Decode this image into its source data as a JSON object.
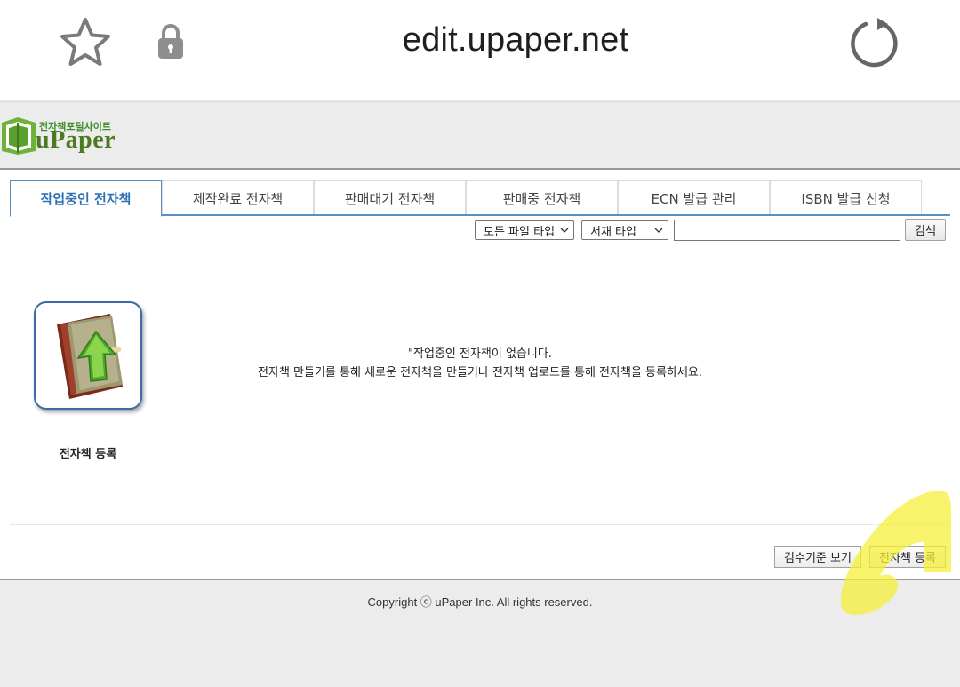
{
  "browser": {
    "url": "edit.upaper.net",
    "icons": [
      "star-icon",
      "lock-icon",
      "reload-icon"
    ]
  },
  "site": {
    "logo_tagline": "전자책포털사이트",
    "logo_name": "uPaper",
    "brand_color": "#4b7a21"
  },
  "tabs": [
    {
      "label": "작업중인 전자책",
      "active": true
    },
    {
      "label": "제작완료 전자책",
      "active": false
    },
    {
      "label": "판매대기 전자책",
      "active": false
    },
    {
      "label": "판매중 전자책",
      "active": false
    },
    {
      "label": "ECN 발급 관리",
      "active": false
    },
    {
      "label": "ISBN 발급 신청",
      "active": false
    }
  ],
  "filters": {
    "file_type": "모든 파일 타입",
    "book_type": "서재 타입",
    "search_value": "",
    "search_button": "검색"
  },
  "content": {
    "register_label": "전자책 등록",
    "empty_line1": "\"작업중인 전자책이 없습니다.",
    "empty_line2": "전자책 만들기를 통해 새로운 전자책을 만들거나 전자책 업로드를 통해 전자책을 등록하세요."
  },
  "actions": {
    "criteria_button": "검수기준 보기",
    "register_button": "전자책 등록"
  },
  "footer": {
    "copyright": "Copyright ⓒ uPaper Inc. All rights reserved."
  },
  "colors": {
    "tab_active": "#2d6fb4",
    "tab_underline": "#5a8fc4",
    "highlight": "#f5ef3a"
  }
}
